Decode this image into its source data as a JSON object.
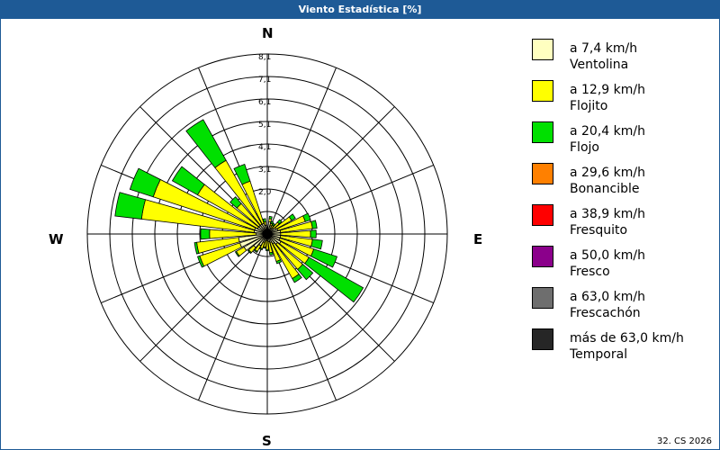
{
  "title": "Viento Estadística [%]",
  "footer": "32. CS 2026",
  "compass": {
    "n": "N",
    "e": "E",
    "s": "S",
    "w": "W"
  },
  "colors": {
    "title_bar": "#1e5a96",
    "grid": "#000000"
  },
  "chart_data": {
    "type": "wind-rose",
    "title": "Viento Estadística [%]",
    "unit": "%",
    "radial_ticks": [
      "2,0",
      "3,1",
      "4,1",
      "5,1",
      "6,1",
      "7,1",
      "8,1"
    ],
    "radial_max": 8.1,
    "ring_count": 8,
    "spoke_count": 16,
    "direction_labels": [
      "N",
      "E",
      "S",
      "W"
    ],
    "bins": [
      {
        "name": "Ventolina",
        "label": "a 7,4 km/h",
        "color": "#ffffc0"
      },
      {
        "name": "Flojito",
        "label": "a 12,9 km/h",
        "color": "#ffff00"
      },
      {
        "name": "Flojo",
        "label": "a 20,4 km/h",
        "color": "#00e000"
      },
      {
        "name": "Bonancible",
        "label": "a 29,6 km/h",
        "color": "#ff8000"
      },
      {
        "name": "Fresquito",
        "label": "a 38,9 km/h",
        "color": "#ff0000"
      },
      {
        "name": "Fresco",
        "label": "a 50,0 km/h",
        "color": "#8b008b"
      },
      {
        "name": "Frescachón",
        "label": "a 63,0 km/h",
        "color": "#6e6e6e"
      },
      {
        "name": "Temporal",
        "label": "más de 63,0 km/h",
        "color": "#262626"
      }
    ],
    "sectors": [
      {
        "angle": 0.0,
        "values": [
          0.05,
          0.0,
          0.0,
          0,
          0,
          0,
          0,
          0
        ]
      },
      {
        "angle": 11.25,
        "values": [
          0.55,
          0.15,
          0.1,
          0,
          0,
          0,
          0,
          0
        ]
      },
      {
        "angle": 22.5,
        "values": [
          0.4,
          0.1,
          0.1,
          0,
          0,
          0,
          0,
          0
        ]
      },
      {
        "angle": 33.75,
        "values": [
          0.3,
          0.15,
          0.1,
          0,
          0,
          0,
          0,
          0
        ]
      },
      {
        "angle": 45.0,
        "values": [
          0.35,
          0.35,
          0.15,
          0,
          0,
          0,
          0,
          0
        ]
      },
      {
        "angle": 56.25,
        "values": [
          0.45,
          0.8,
          0.2,
          0,
          0,
          0,
          0,
          0
        ]
      },
      {
        "angle": 67.5,
        "values": [
          0.5,
          1.3,
          0.25,
          0,
          0,
          0,
          0,
          0
        ]
      },
      {
        "angle": 78.75,
        "values": [
          0.6,
          1.45,
          0.2,
          0,
          0,
          0,
          0,
          0
        ]
      },
      {
        "angle": 90.0,
        "values": [
          0.6,
          1.35,
          0.25,
          0,
          0,
          0,
          0,
          0
        ]
      },
      {
        "angle": 101.25,
        "values": [
          0.6,
          1.45,
          0.45,
          0,
          0,
          0,
          0,
          0
        ]
      },
      {
        "angle": 112.5,
        "values": [
          0.6,
          1.6,
          1.1,
          0,
          0,
          0,
          0,
          0
        ]
      },
      {
        "angle": 123.75,
        "values": [
          0.7,
          1.45,
          2.8,
          0,
          0,
          0,
          0,
          0
        ]
      },
      {
        "angle": 135.0,
        "values": [
          0.6,
          1.5,
          0.6,
          0,
          0,
          0,
          0,
          0
        ]
      },
      {
        "angle": 146.25,
        "values": [
          0.5,
          1.8,
          0.2,
          0,
          0,
          0,
          0,
          0
        ]
      },
      {
        "angle": 157.5,
        "values": [
          0.4,
          0.9,
          0.1,
          0,
          0,
          0,
          0,
          0
        ]
      },
      {
        "angle": 168.75,
        "values": [
          0.35,
          0.5,
          0.1,
          0,
          0,
          0,
          0,
          0
        ]
      },
      {
        "angle": 180.0,
        "values": [
          0.3,
          0.4,
          0.05,
          0,
          0,
          0,
          0,
          0
        ]
      },
      {
        "angle": 191.25,
        "values": [
          0.3,
          0.3,
          0.05,
          0,
          0,
          0,
          0,
          0
        ]
      },
      {
        "angle": 202.5,
        "values": [
          0.4,
          0.3,
          0.05,
          0,
          0,
          0,
          0,
          0
        ]
      },
      {
        "angle": 213.75,
        "values": [
          0.6,
          0.3,
          0.05,
          0,
          0,
          0,
          0,
          0
        ]
      },
      {
        "angle": 225.0,
        "values": [
          0.8,
          0.3,
          0.05,
          0,
          0,
          0,
          0,
          0
        ]
      },
      {
        "angle": 236.25,
        "values": [
          1.2,
          0.4,
          0.05,
          0,
          0,
          0,
          0,
          0
        ]
      },
      {
        "angle": 247.5,
        "values": [
          1.3,
          1.9,
          0.1,
          0,
          0,
          0,
          0,
          0
        ]
      },
      {
        "angle": 258.75,
        "values": [
          1.3,
          1.9,
          0.1,
          0,
          0,
          0,
          0,
          0
        ]
      },
      {
        "angle": 270.0,
        "values": [
          0.5,
          2.1,
          0.4,
          0,
          0,
          0,
          0,
          0
        ]
      },
      {
        "angle": 281.25,
        "values": [
          0.6,
          5.1,
          1.2,
          0,
          0,
          0,
          0,
          0
        ]
      },
      {
        "angle": 292.5,
        "values": [
          0.6,
          4.8,
          1.1,
          0,
          0,
          0,
          0,
          0
        ]
      },
      {
        "angle": 303.75,
        "values": [
          0.5,
          3.1,
          1.3,
          0,
          0,
          0,
          0,
          0
        ]
      },
      {
        "angle": 315.0,
        "values": [
          0.5,
          1.3,
          0.4,
          0,
          0,
          0,
          0,
          0
        ]
      },
      {
        "angle": 326.25,
        "values": [
          0.5,
          3.3,
          2.1,
          0,
          0,
          0,
          0,
          0
        ]
      },
      {
        "angle": 337.5,
        "values": [
          0.5,
          2.0,
          0.8,
          0,
          0,
          0,
          0,
          0
        ]
      },
      {
        "angle": 348.75,
        "values": [
          0.4,
          0.15,
          0.15,
          0,
          0,
          0,
          0,
          0
        ]
      }
    ]
  }
}
